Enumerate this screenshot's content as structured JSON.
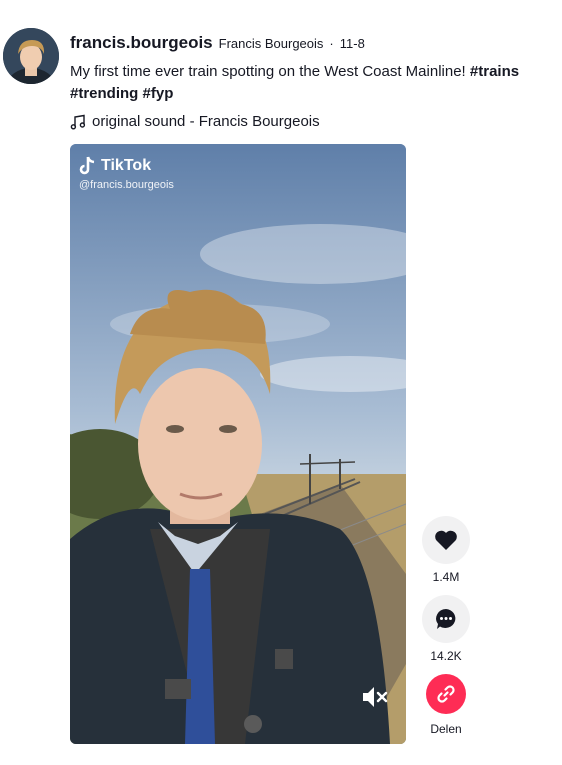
{
  "post": {
    "username": "francis.bourgeois",
    "nickname": "Francis Bourgeois",
    "separator": "·",
    "date": "11-8",
    "caption_text": "My first time ever train spotting on the West Coast Mainline! ",
    "hashtags": [
      "#trains",
      "#trending",
      "#fyp"
    ],
    "music": "original sound - Francis Bourgeois"
  },
  "video": {
    "watermark_brand": "TikTok",
    "watermark_handle": "@francis.bourgeois",
    "muted": true
  },
  "actions": {
    "likes": "1.4M",
    "comments": "14.2K",
    "share_label": "Delen"
  },
  "icons": {
    "music": "music-note-icon",
    "like": "heart-icon",
    "comment": "comment-icon",
    "share": "link-icon",
    "mute": "speaker-muted-icon"
  },
  "colors": {
    "share_bg": "#fe2c55",
    "action_bg": "#f1f1f2",
    "text": "#161823"
  }
}
